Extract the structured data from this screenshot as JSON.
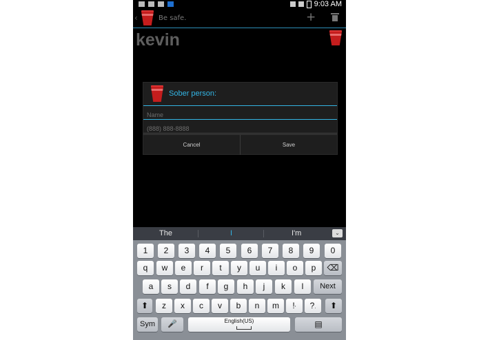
{
  "status_bar": {
    "time": "9:03 AM",
    "left_icons": [
      "usb-icon",
      "keyboard-icon",
      "image-icon",
      "notification-icon"
    ],
    "right_icons": [
      "mute-icon",
      "wifi-icon",
      "battery-icon"
    ]
  },
  "action_bar": {
    "title": "Be safe.",
    "back_glyph": "‹",
    "add_glyph": "+",
    "icons": [
      "back-icon",
      "red-cup-icon",
      "add-icon",
      "trash-icon"
    ]
  },
  "main": {
    "name_heading": "kevin"
  },
  "dialog": {
    "title": "Sober person:",
    "name_placeholder": "Name",
    "name_value": "",
    "phone_placeholder": "(888) 888-8888",
    "phone_value": "",
    "cancel_label": "Cancel",
    "save_label": "Save"
  },
  "keyboard": {
    "suggestions": [
      "The",
      "I",
      "I'm"
    ],
    "collapse_glyph": "⌄",
    "number_row": [
      "1",
      "2",
      "3",
      "4",
      "5",
      "6",
      "7",
      "8",
      "9",
      "0"
    ],
    "row1": [
      "q",
      "w",
      "e",
      "r",
      "t",
      "y",
      "u",
      "i",
      "o",
      "p"
    ],
    "row2": [
      "a",
      "s",
      "d",
      "f",
      "g",
      "h",
      "j",
      "k",
      "l"
    ],
    "row3": [
      "z",
      "x",
      "c",
      "v",
      "b",
      "n",
      "m",
      "!",
      "?"
    ],
    "row3_sub": [
      ",",
      "."
    ],
    "next_label": "Next",
    "sym_label": "Sym",
    "space_label": "English(US)",
    "shift_glyph": "⬆",
    "backspace_glyph": "⌫",
    "mic_glyph": "🎤",
    "clipboard_glyph": "▤"
  },
  "colors": {
    "accent": "#33b5e5",
    "cup_red": "#c41d1d",
    "background": "#000000",
    "dialog_bg": "#1e1e1e",
    "keyboard_bg": "#8a8f96"
  }
}
